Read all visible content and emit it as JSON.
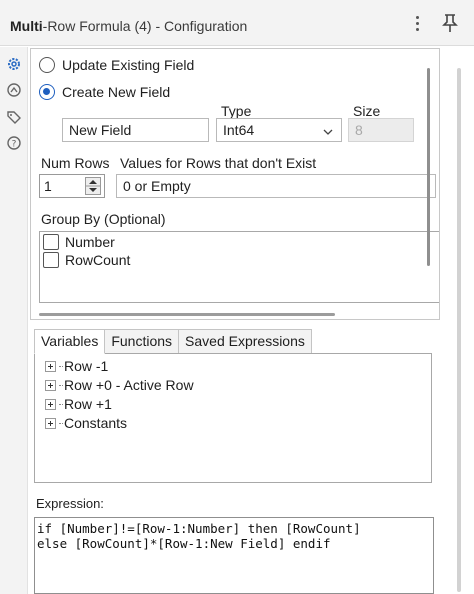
{
  "window": {
    "title_bold": "Multi",
    "title_rest": "-Row Formula (4) - Configuration"
  },
  "output": {
    "update_existing_label": "Update Existing Field",
    "create_new_label": "Create New  Field",
    "selected_option": "create_new",
    "field_name_value": "New Field",
    "type_label": "Type",
    "type_value": "Int64",
    "size_label": "Size",
    "size_value": "8"
  },
  "rows": {
    "num_rows_label": "Num Rows",
    "num_rows_value": "1",
    "nonexist_label": "Values for Rows that don't Exist",
    "nonexist_value": "0 or Empty"
  },
  "group_by": {
    "label": "Group By (Optional)",
    "items": [
      "Number",
      "RowCount"
    ]
  },
  "tabs": [
    {
      "label": "Variables",
      "active": true
    },
    {
      "label": "Functions",
      "active": false
    },
    {
      "label": "Saved Expressions",
      "active": false
    }
  ],
  "tree": [
    {
      "label": "Row -1"
    },
    {
      "label": "Row +0 - Active Row"
    },
    {
      "label": "Row +1"
    },
    {
      "label": "Constants"
    }
  ],
  "expression": {
    "label": "Expression:",
    "line1": "if [Number]!=[Row-1:Number] then [RowCount]",
    "line2": "else [RowCount]*[Row-1:New Field] endif"
  },
  "icons": {
    "rail": [
      "gear-icon",
      "node-icon",
      "tag-icon",
      "help-icon"
    ],
    "accent": "#1f5fbf"
  }
}
